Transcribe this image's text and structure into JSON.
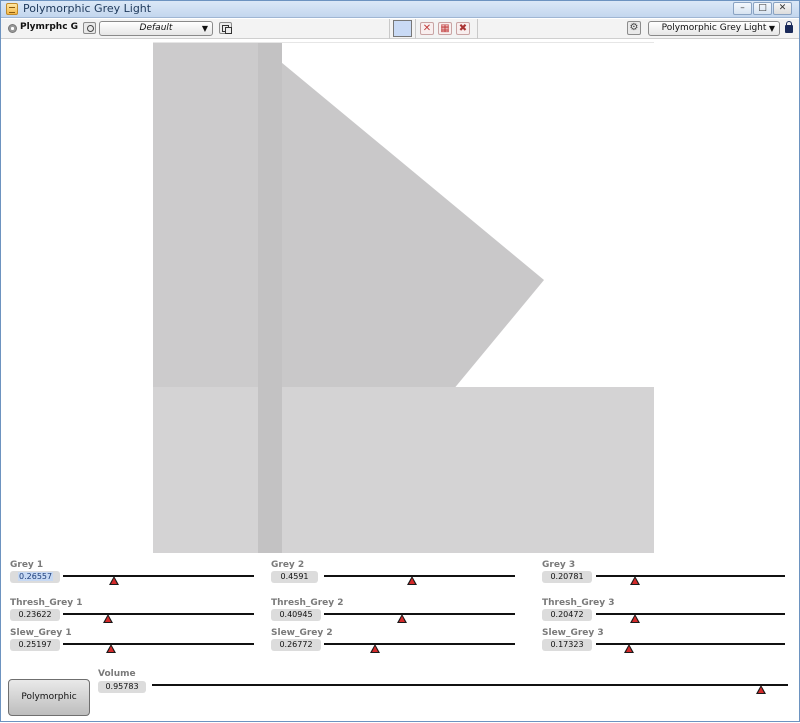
{
  "window": {
    "title": "Polymorphic Grey Light"
  },
  "toolbar": {
    "instrument_name": "Plymrphc G",
    "preset": "Default",
    "theme": "Polymorphic Grey Light"
  },
  "shapes": [
    {
      "name": "triangle",
      "color": "#c9c8c9"
    },
    {
      "name": "left-panel",
      "color": "#cccbcc"
    },
    {
      "name": "vertical-strip",
      "color": "#c3c2c3"
    },
    {
      "name": "bottom-panel",
      "color": "#d4d3d4"
    }
  ],
  "params": [
    {
      "id": "grey-1",
      "label": "Grey 1",
      "value": "0.26557",
      "fraction": 0.26557,
      "selected": true
    },
    {
      "id": "grey-2",
      "label": "Grey 2",
      "value": "0.4591",
      "fraction": 0.4591
    },
    {
      "id": "grey-3",
      "label": "Grey 3",
      "value": "0.20781",
      "fraction": 0.20781
    },
    {
      "id": "thresh-grey-1",
      "label": "Thresh_Grey 1",
      "value": "0.23622",
      "fraction": 0.23622
    },
    {
      "id": "thresh-grey-2",
      "label": "Thresh_Grey 2",
      "value": "0.40945",
      "fraction": 0.40945
    },
    {
      "id": "thresh-grey-3",
      "label": "Thresh_Grey 3",
      "value": "0.20472",
      "fraction": 0.20472
    },
    {
      "id": "slew-grey-1",
      "label": "Slew_Grey 1",
      "value": "0.25197",
      "fraction": 0.25197
    },
    {
      "id": "slew-grey-2",
      "label": "Slew_Grey 2",
      "value": "0.26772",
      "fraction": 0.26772
    },
    {
      "id": "slew-grey-3",
      "label": "Slew_Grey 3",
      "value": "0.17323",
      "fraction": 0.17323
    },
    {
      "id": "volume",
      "label": "Volume",
      "value": "0.95783",
      "fraction": 0.95783
    }
  ],
  "mode_button": {
    "label": "Polymorphic"
  }
}
